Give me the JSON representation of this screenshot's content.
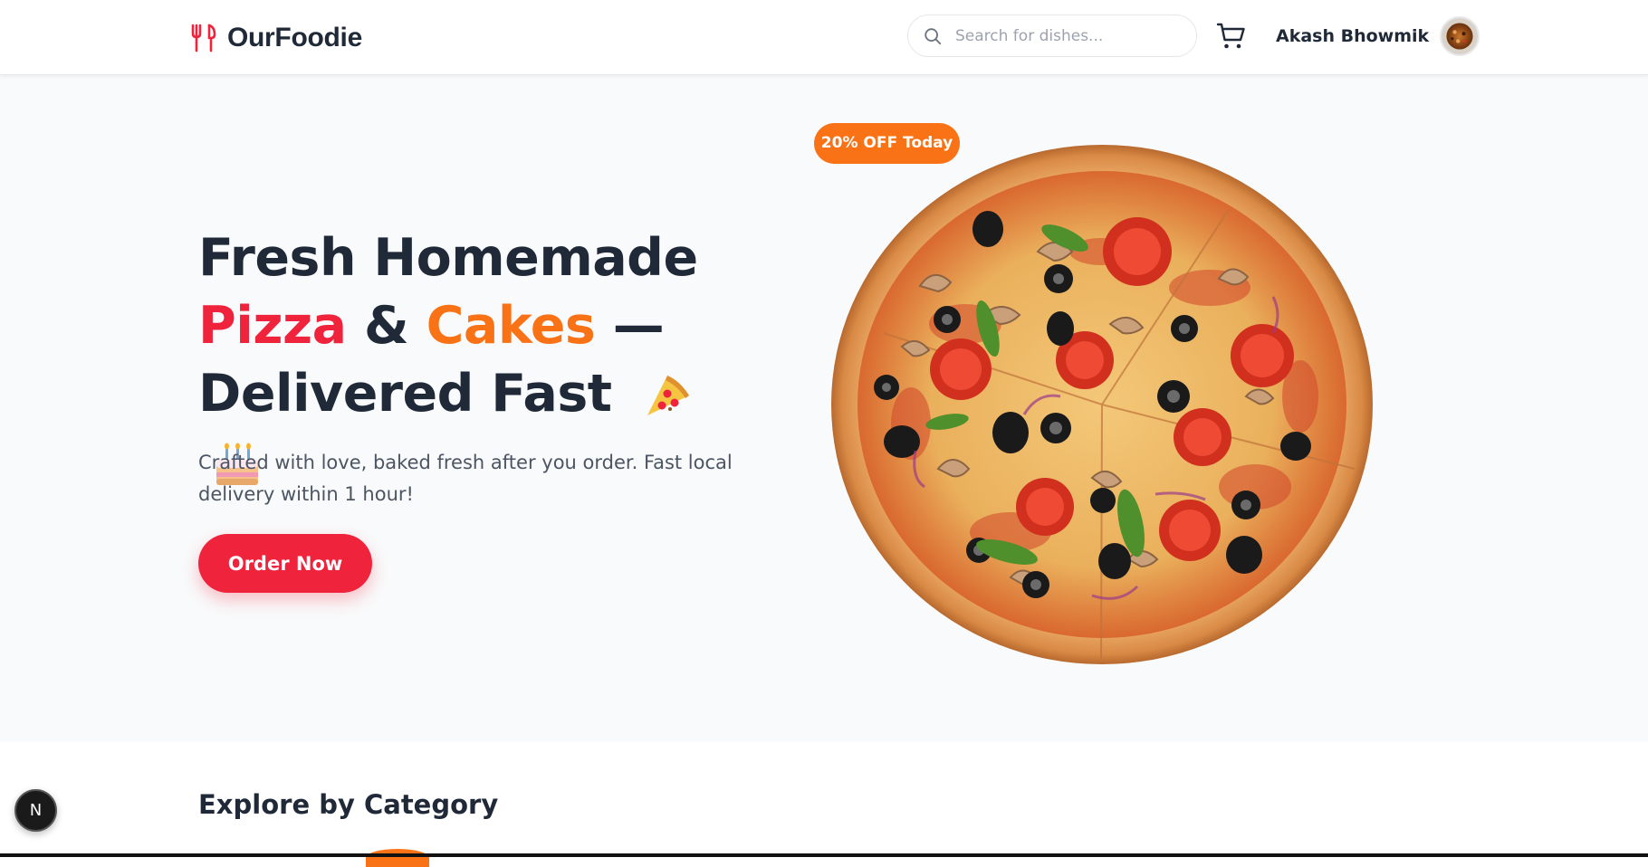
{
  "header": {
    "logo_text": "OurFoodie",
    "logo_icon": "fork-knife-icon",
    "search": {
      "placeholder": "Search for dishes...",
      "value": ""
    },
    "cart_icon": "shopping-cart-icon",
    "user": {
      "name": "Akash Bhowmik"
    }
  },
  "hero": {
    "badge": "20% OFF Today",
    "title": {
      "line1": "Fresh Homemade",
      "pizza": "Pizza",
      "amp": "&",
      "cakes": "Cakes",
      "dash": "—",
      "line3": "Delivered Fast",
      "emoji_1": "pizza-emoji",
      "emoji_2": "cake-emoji"
    },
    "subtitle": "Crafted with love, baked fresh after you order. Fast local delivery within 1 hour!",
    "cta_label": "Order Now"
  },
  "categories": {
    "title": "Explore by Category"
  },
  "dev_badge": {
    "label": "N"
  },
  "colors": {
    "accent_red": "#ef233c",
    "accent_orange": "#f97316",
    "text_dark": "#1f2937",
    "hero_bg": "#f9fafb"
  }
}
